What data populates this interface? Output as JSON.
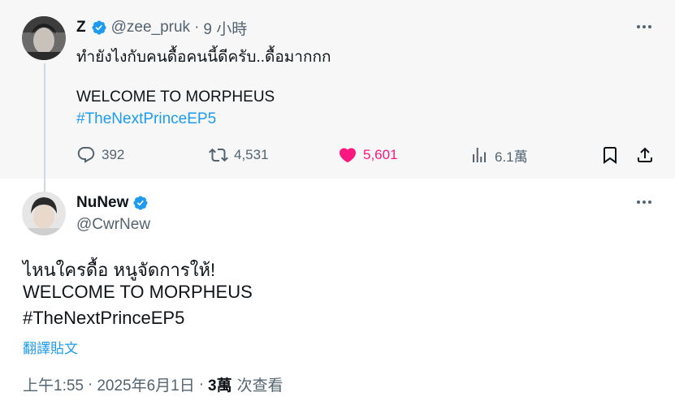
{
  "parent": {
    "name": "Z",
    "handle": "@zee_pruk",
    "dot": "·",
    "time": "9 小時",
    "line1": "ทำยังไงกับคนดื้อคนนี้ดีครับ..ดื้อมากกก",
    "line2": "WELCOME TO MORPHEUS",
    "hashtag": "#TheNextPrinceEP5",
    "actions": {
      "replies": "392",
      "retweets": "4,531",
      "likes": "5,601",
      "views": "6.1萬"
    }
  },
  "main": {
    "name": "NuNew",
    "handle": "@CwrNew",
    "line1": "ไหนใครดื้อ หนูจัดการให้!",
    "line2": "WELCOME TO MORPHEUS",
    "hashtag": "#TheNextPrinceEP5",
    "translate": "翻譯貼文",
    "time": "上午1:55",
    "sep": "·",
    "date": "2025年6月1日",
    "views_count": "3萬",
    "views_label": "次查看"
  },
  "colors": {
    "accent": "#1d9bf0",
    "like": "#f91880",
    "muted": "#536471",
    "text": "#0f1419",
    "parent_bg": "#f7f7f7"
  },
  "icons": [
    "verified-badge-icon",
    "more-icon",
    "reply-icon",
    "retweet-icon",
    "heart-icon",
    "views-icon",
    "bookmark-icon",
    "share-icon"
  ]
}
